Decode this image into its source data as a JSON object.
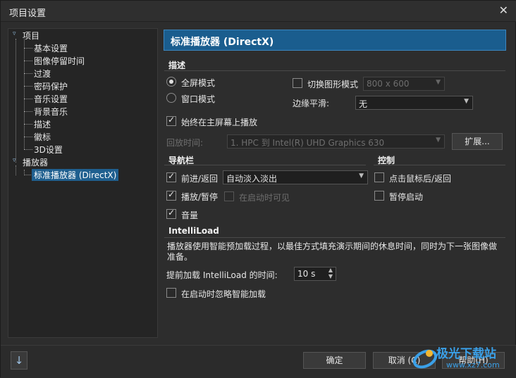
{
  "window": {
    "title": "项目设置",
    "close_icon": "close-icon"
  },
  "tree": {
    "root_project": "项目",
    "items": [
      "基本设置",
      "图像停留时间",
      "过渡",
      "密码保护",
      "音乐设置",
      "背景音乐",
      "描述",
      "徽标",
      "3D设置"
    ],
    "root_player": "播放器",
    "player_items": [
      "标准播放器 (DirectX)"
    ]
  },
  "panel": {
    "title": "标准播放器 (DirectX)"
  },
  "describe": {
    "section": "描述",
    "fullscreen_label": "全屏模式",
    "windowed_label": "窗口模式",
    "switch_mode_label": "切换图形模式",
    "resolution_value": "800 x 600",
    "edge_smooth_label": "边缘平滑:",
    "edge_smooth_value": "无",
    "main_screen_label": "始终在主屏幕上播放",
    "playback_label": "回放时间:",
    "playback_value": "1. HPC 到 Intel(R) UHD Graphics 630",
    "expand_button": "扩展..."
  },
  "nav": {
    "section": "导航栏",
    "forward_back_label": "前进/返回",
    "forward_back_value": "自动淡入淡出",
    "play_pause_label": "播放/暂停",
    "visible_on_start_label": "在启动时可见",
    "volume_label": "音量"
  },
  "control": {
    "section": "控制",
    "click_mouse_label": "点击鼠标后/返回",
    "pause_start_label": "暂停启动"
  },
  "intelli": {
    "section": "IntelliLoad",
    "description": "播放器使用智能预加载过程，以最佳方式填充演示期间的休息时间，同时为下一张图像做准备。",
    "preload_label": "提前加载 IntelliLoad 的时间:",
    "preload_value": "10 s",
    "ignore_label": "在启动时忽略智能加载"
  },
  "footer": {
    "ok": "确定",
    "cancel": "取消 (C)",
    "help": "帮助(H)",
    "download_icon": "arrow-down-icon",
    "watermark_text": "极光下载站",
    "watermark_url": "www.xz7.com"
  },
  "colors": {
    "accent": "#1a5d8e",
    "background": "#2d2d2d"
  }
}
